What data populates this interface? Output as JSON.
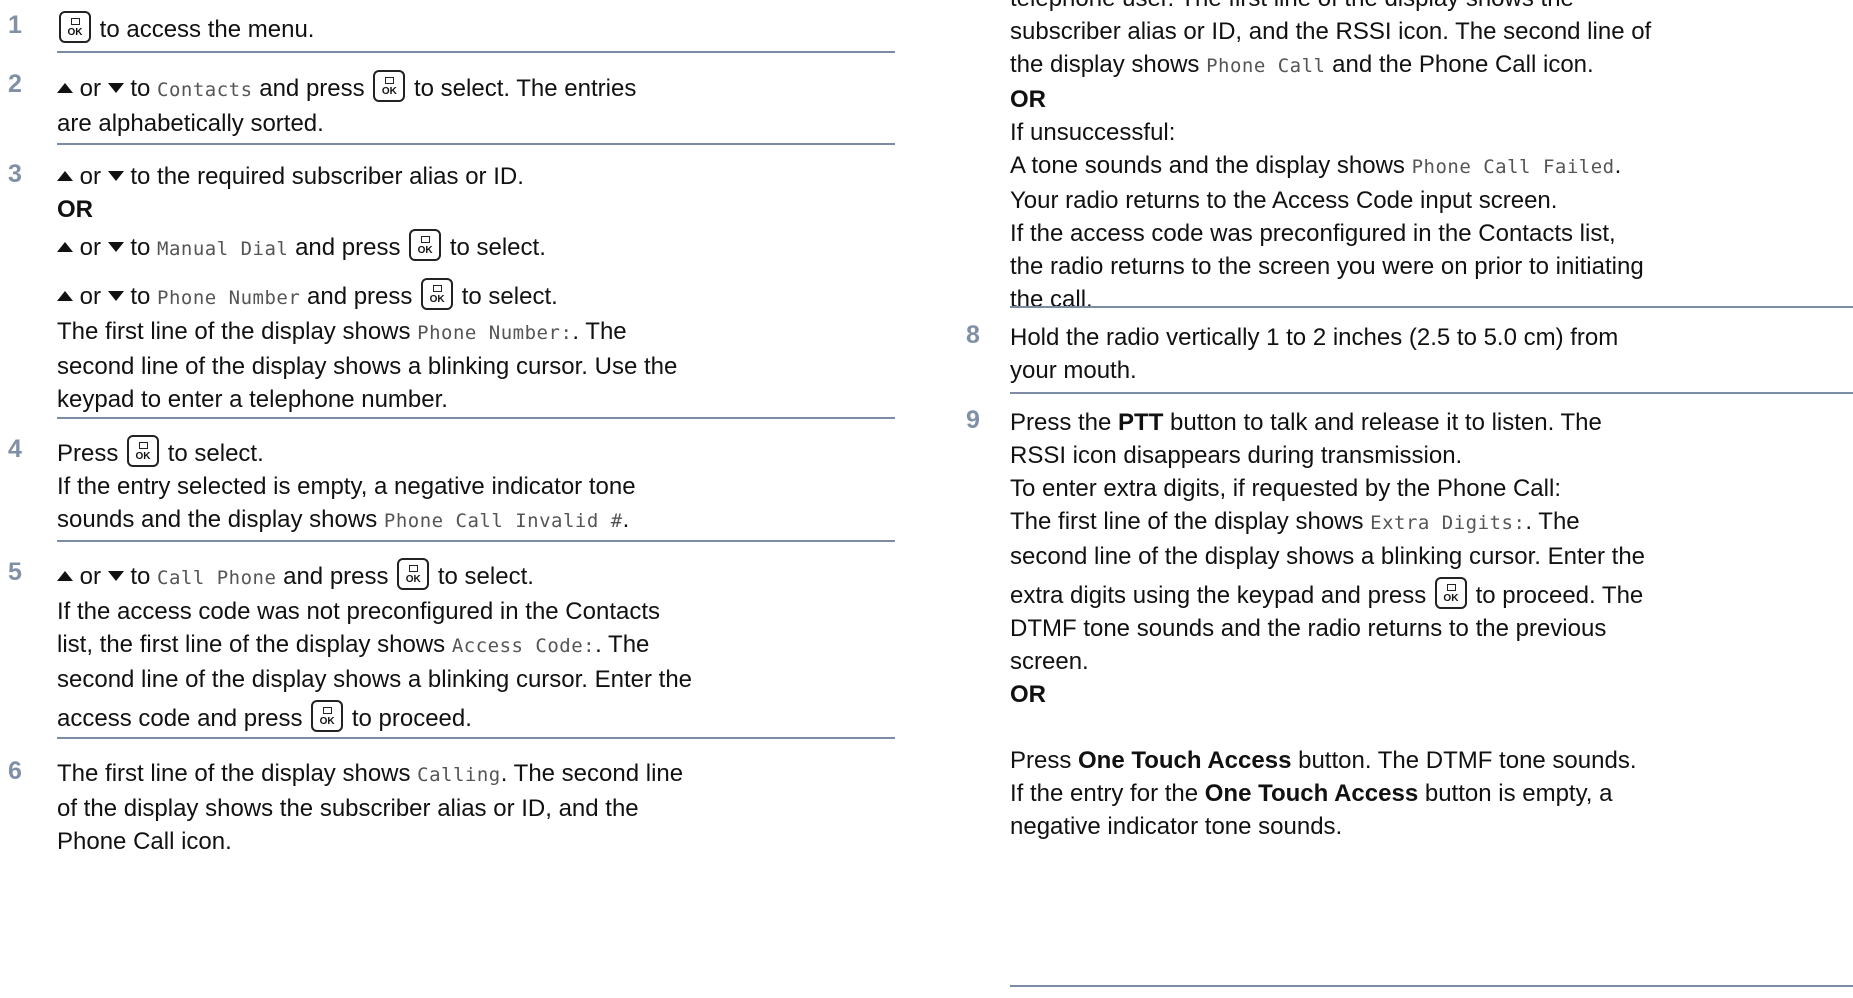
{
  "common": {
    "or": "OR",
    "ok_icon_label": "OK",
    "press": "Press",
    "or_word": "or",
    "to": "to",
    "and_press": "and press",
    "to_select": "to select."
  },
  "left": {
    "s1": {
      "num": "1",
      "text": "to access the menu."
    },
    "s2": {
      "num": "2",
      "menu": "Contacts",
      "rest1": "to select. The entries",
      "rest2": "are alphabetically sorted."
    },
    "s3": {
      "num": "3",
      "l1": "to the required subscriber alias or ID.",
      "menu_manual": "Manual Dial",
      "menu_phone": "Phone Number",
      "p1a": "The first line of the display shows ",
      "p1m": "Phone Number:",
      "p1b": ". The",
      "p2": "second line of the display shows a blinking cursor. Use the",
      "p3": "keypad to enter a telephone number."
    },
    "s4": {
      "num": "4",
      "select": "to select.",
      "l2": "If the entry selected is empty, a negative indicator tone",
      "l3a": "sounds and the display shows ",
      "l3m": "Phone Call Invalid #",
      "l3b": "."
    },
    "s5": {
      "num": "5",
      "menu": "Call Phone",
      "l2": "If the access code was not preconfigured in the Contacts",
      "l3a": "list, the first line of the display shows ",
      "l3m": "Access Code:",
      "l3b": ". The",
      "l4": "second line of the display shows a blinking cursor. Enter the",
      "l5a": "access code and press",
      "l5b": "to proceed."
    },
    "s6": {
      "num": "6",
      "l1a": "The first line of the display shows ",
      "l1m": "Calling",
      "l1b": ". The second line",
      "l2": "of the display shows the subscriber alias or ID, and the",
      "l3": "Phone Call icon."
    }
  },
  "right": {
    "top": {
      "l0": "telephone user. The first line of the display shows the",
      "l1": "subscriber alias or ID, and the RSSI icon. The second line of",
      "l2a": "the display shows ",
      "l2m": "Phone Call",
      "l2b": " and the Phone Call icon.",
      "l4": "If unsuccessful:",
      "l5a": "A tone sounds and the display shows ",
      "l5m": "Phone Call Failed",
      "l5b": ".",
      "l6": "Your radio returns to the Access Code input screen.",
      "l7": "If the access code was preconfigured in the Contacts list,",
      "l8": "the radio returns to the screen you were on prior to initiating",
      "l9": "the call."
    },
    "s8": {
      "num": "8",
      "l1": "Hold the radio vertically 1 to 2 inches (2.5 to 5.0 cm) from",
      "l2": "your mouth."
    },
    "s9": {
      "num": "9",
      "l1a": "Press the ",
      "l1b": "PTT",
      "l1c": " button to talk and release it to listen. The",
      "l2": "RSSI icon disappears during transmission.",
      "l3": "To enter extra digits, if requested by the Phone Call:",
      "l4a": "The first line of the display shows ",
      "l4m": "Extra Digits:",
      "l4b": ". The",
      "l5": "second line of the display shows a blinking cursor. Enter the",
      "l6a": "extra digits using the keypad and press",
      "l6b": "to proceed. The",
      "l7": "DTMF tone sounds and the radio returns to the previous",
      "l8": "screen.",
      "l10a": "Press ",
      "l10b": "One Touch Access",
      "l10c": " button. The DTMF tone sounds.",
      "l11a": "If the entry for the ",
      "l11b": "One Touch Access",
      "l11c": " button is empty, a",
      "l12": "negative indicator tone sounds."
    }
  }
}
